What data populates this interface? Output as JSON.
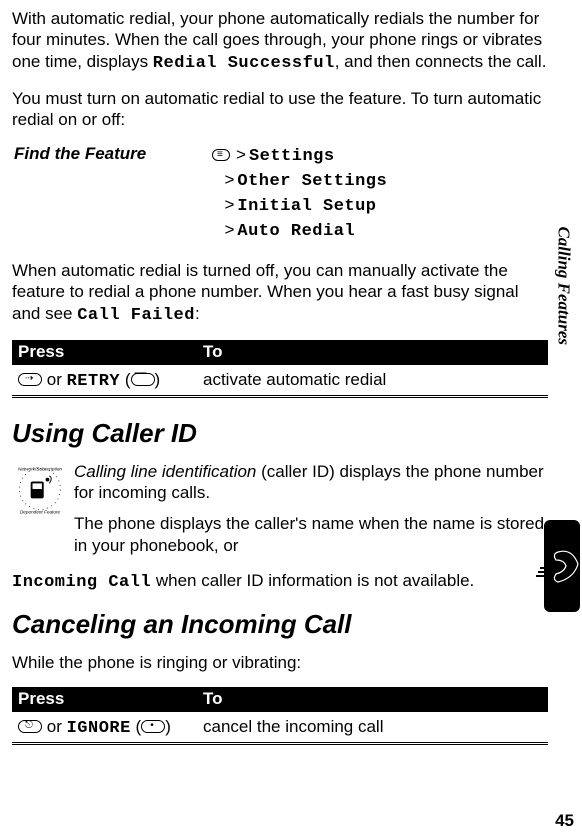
{
  "intro": {
    "p1_pre": "With automatic redial, your phone automatically redials the number for four minutes. When the call goes through, your phone rings or vibrates one time, displays ",
    "p1_mono": "Redial Successful",
    "p1_post": ", and then connects the call.",
    "p2": "You must turn on automatic redial to use the feature. To turn automatic redial on or off:"
  },
  "feature": {
    "label": "Find the Feature",
    "step1": "Settings",
    "step2": "Other Settings",
    "step3": "Initial Setup",
    "step4": "Auto Redial"
  },
  "manual": {
    "p_pre": "When automatic redial is turned off, you can manually activate the feature to redial a phone number. When you hear a fast busy signal and see ",
    "p_mono": "Call Failed",
    "p_post": ":"
  },
  "table1": {
    "head1": "Press",
    "head2": "To",
    "cell1_or": "or",
    "cell1_retry": "RETRY",
    "cell2": "activate automatic redial"
  },
  "callerid": {
    "heading": "Using Caller ID",
    "p1_pre_em": "Calling line identification",
    "p1_post": " (caller ID) displays the phone number for incoming calls.",
    "p2": "The phone displays the caller's name when the name is stored in your phonebook, or ",
    "cont_mono": "Incoming Call",
    "cont_post": " when caller ID information is not available."
  },
  "cancel": {
    "heading": "Canceling an Incoming Call",
    "p1": "While the phone is ringing or vibrating:"
  },
  "table2": {
    "head1": "Press",
    "head2": "To",
    "cell1_or": "or",
    "cell1_ignore": "IGNORE",
    "cell2": "cancel the incoming call"
  },
  "side": {
    "label": "Calling Features"
  },
  "page_number": "45"
}
